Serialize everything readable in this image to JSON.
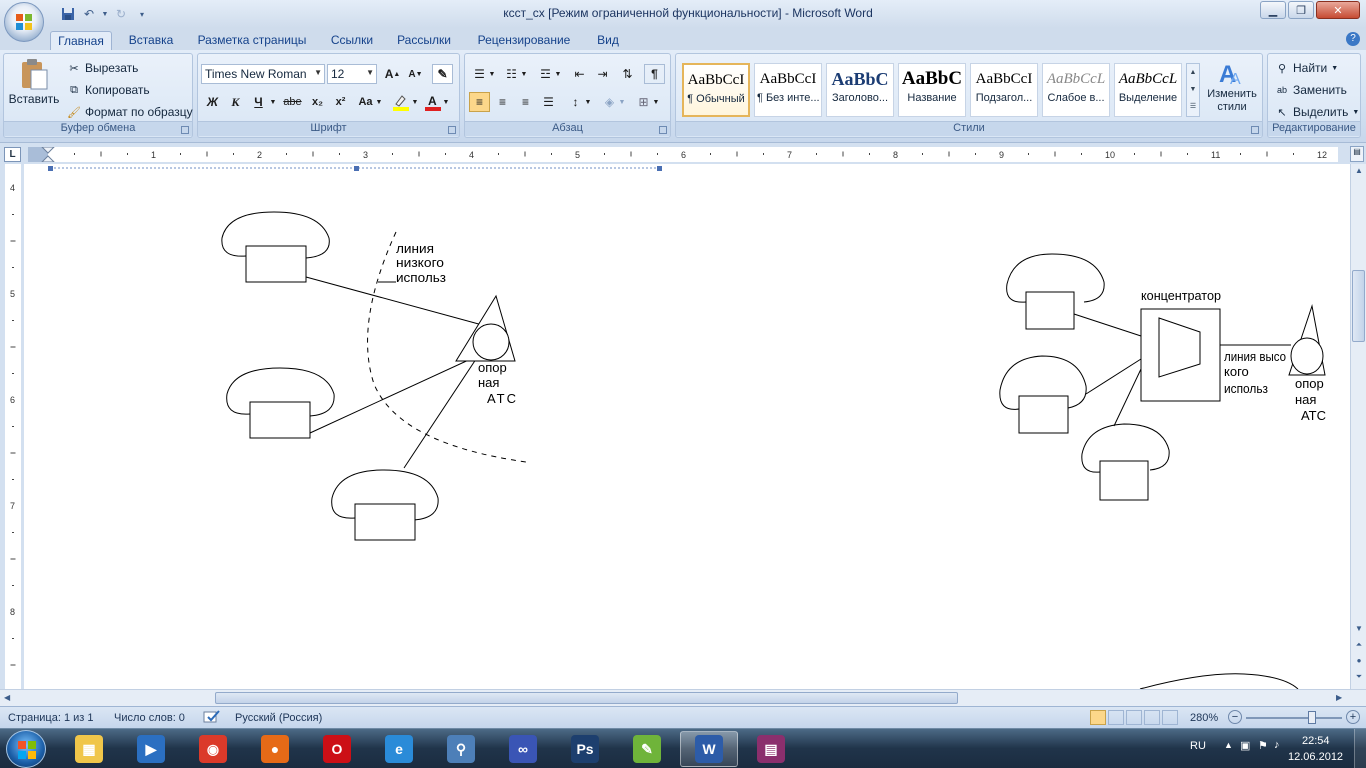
{
  "window": {
    "title": "ксст_сх [Режим ограниченной функциональности] - Microsoft Word"
  },
  "tabs": [
    "Главная",
    "Вставка",
    "Разметка страницы",
    "Ссылки",
    "Рассылки",
    "Рецензирование",
    "Вид"
  ],
  "active_tab": "Главная",
  "clipboard": {
    "paste": "Вставить",
    "cut": "Вырезать",
    "copy": "Копировать",
    "format_painter": "Формат по образцу",
    "group_label": "Буфер обмена"
  },
  "font": {
    "font_name": "Times New Roman",
    "font_size": "12",
    "bold": "Ж",
    "italic": "К",
    "underline": "Ч",
    "strikethrough": "abe",
    "subscript": "x₂",
    "superscript": "x²",
    "change_case": "Aa",
    "group_label": "Шрифт"
  },
  "paragraph": {
    "group_label": "Абзац"
  },
  "styles": {
    "items": [
      {
        "sample": "AaBbCcI",
        "name": "¶ Обычный"
      },
      {
        "sample": "AaBbCcI",
        "name": "¶ Без инте..."
      },
      {
        "sample": "AaBbC",
        "name": "Заголово..."
      },
      {
        "sample": "AaBbC",
        "name": "Название"
      },
      {
        "sample": "AaBbCcI",
        "name": "Подзагол..."
      },
      {
        "sample": "AaBbCcL",
        "name": "Слабое в..."
      },
      {
        "sample": "AaBbCcL",
        "name": "Выделение"
      }
    ],
    "change_styles": "Изменить стили",
    "group_label": "Стили"
  },
  "editing": {
    "find": "Найти",
    "replace": "Заменить",
    "select": "Выделить",
    "group_label": "Редактирование"
  },
  "ruler": {
    "h_numbers": [
      "1",
      "2",
      "3",
      "4",
      "5",
      "6",
      "7",
      "8",
      "9",
      "10",
      "11",
      "12"
    ],
    "v_numbers": [
      "4",
      "5",
      "6",
      "7",
      "8"
    ]
  },
  "diagram_left": {
    "line_label": [
      "линия",
      "низкого",
      "использ"
    ],
    "station_label": [
      "опор",
      "ная",
      "АТС"
    ]
  },
  "diagram_right": {
    "concentrator_label": "концентратор",
    "line_label": [
      "линия высо",
      "кого",
      "использ"
    ],
    "station_label": [
      "опор",
      "ная",
      "АТС"
    ]
  },
  "statusbar": {
    "page": "Страница: 1 из 1",
    "words": "Число слов: 0",
    "language": "Русский (Россия)",
    "zoom": "280%"
  },
  "taskbar": {
    "language": "RU",
    "time": "22:54",
    "date": "12.06.2012",
    "apps": [
      "explorer-icon",
      "media-player-icon",
      "chrome-icon",
      "firefox-icon",
      "opera-icon",
      "ie-icon",
      "search-tool-icon",
      "infinity-app-icon",
      "photoshop-icon",
      "notepadpp-icon",
      "word-icon",
      "winrar-icon"
    ]
  },
  "colors": {
    "ribbon_bg": "#d3e1f2",
    "taskbar_bg": "#20344a",
    "accent": "#15428b"
  }
}
